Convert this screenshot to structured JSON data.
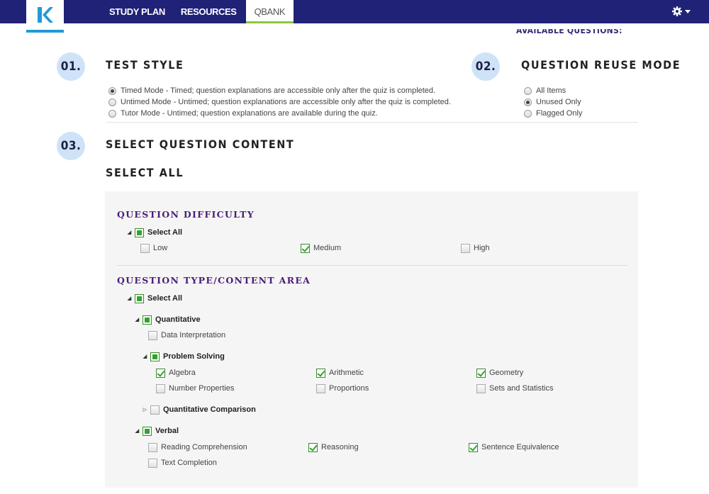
{
  "nav": {
    "logo_letter": "K",
    "items": [
      {
        "label": "STUDY PLAN",
        "active": false
      },
      {
        "label": "RESOURCES",
        "active": false
      },
      {
        "label": "QBANK",
        "active": true
      }
    ],
    "settings_icon": "gear-icon"
  },
  "available_questions_label": "AVAILABLE QUESTIONS:",
  "test_style": {
    "number": "01.",
    "title": "TEST STYLE",
    "options": [
      {
        "label": "Timed Mode - Timed; question explanations are accessible only after the quiz is completed.",
        "selected": true
      },
      {
        "label": "Untimed Mode - Untimed; question explanations are accessible only after the quiz is completed.",
        "selected": false
      },
      {
        "label": "Tutor Mode - Untimed; question explanations are available during the quiz.",
        "selected": false
      }
    ]
  },
  "reuse_mode": {
    "number": "02.",
    "title": "QUESTION REUSE MODE",
    "options": [
      {
        "label": "All Items",
        "selected": false
      },
      {
        "label": "Unused Only",
        "selected": true
      },
      {
        "label": "Flagged Only",
        "selected": false
      }
    ]
  },
  "content": {
    "number": "03.",
    "title": "SELECT QUESTION CONTENT",
    "select_all_heading": "SELECT ALL",
    "difficulty": {
      "heading": "QUESTION DIFFICULTY",
      "select_all": "Select All",
      "items": [
        {
          "label": "Low",
          "checked": false
        },
        {
          "label": "Medium",
          "checked": true
        },
        {
          "label": "High",
          "checked": false
        }
      ]
    },
    "type_area": {
      "heading": "QUESTION TYPE/CONTENT AREA",
      "select_all": "Select All",
      "quantitative": "Quantitative",
      "data_interpretation": "Data Interpretation",
      "problem_solving": "Problem Solving",
      "ps_items": [
        {
          "label": "Algebra",
          "checked": true
        },
        {
          "label": "Arithmetic",
          "checked": true
        },
        {
          "label": "Geometry",
          "checked": true
        },
        {
          "label": "Number Properties",
          "checked": false
        },
        {
          "label": "Proportions",
          "checked": false
        },
        {
          "label": "Sets and Statistics",
          "checked": false
        }
      ],
      "quant_comparison": "Quantitative Comparison",
      "verbal": "Verbal",
      "verbal_items": [
        {
          "label": "Reading Comprehension",
          "checked": false
        },
        {
          "label": "Reasoning",
          "checked": true
        },
        {
          "label": "Sentence Equivalence",
          "checked": true
        },
        {
          "label": "Text Completion",
          "checked": false
        }
      ]
    }
  },
  "colors": {
    "nav_bg": "#1f2276",
    "accent_blue": "#1f9bd7",
    "heading_purple": "#4b1d7a",
    "check_green": "#2fa52a",
    "badge_bg": "#cfe3f8"
  }
}
